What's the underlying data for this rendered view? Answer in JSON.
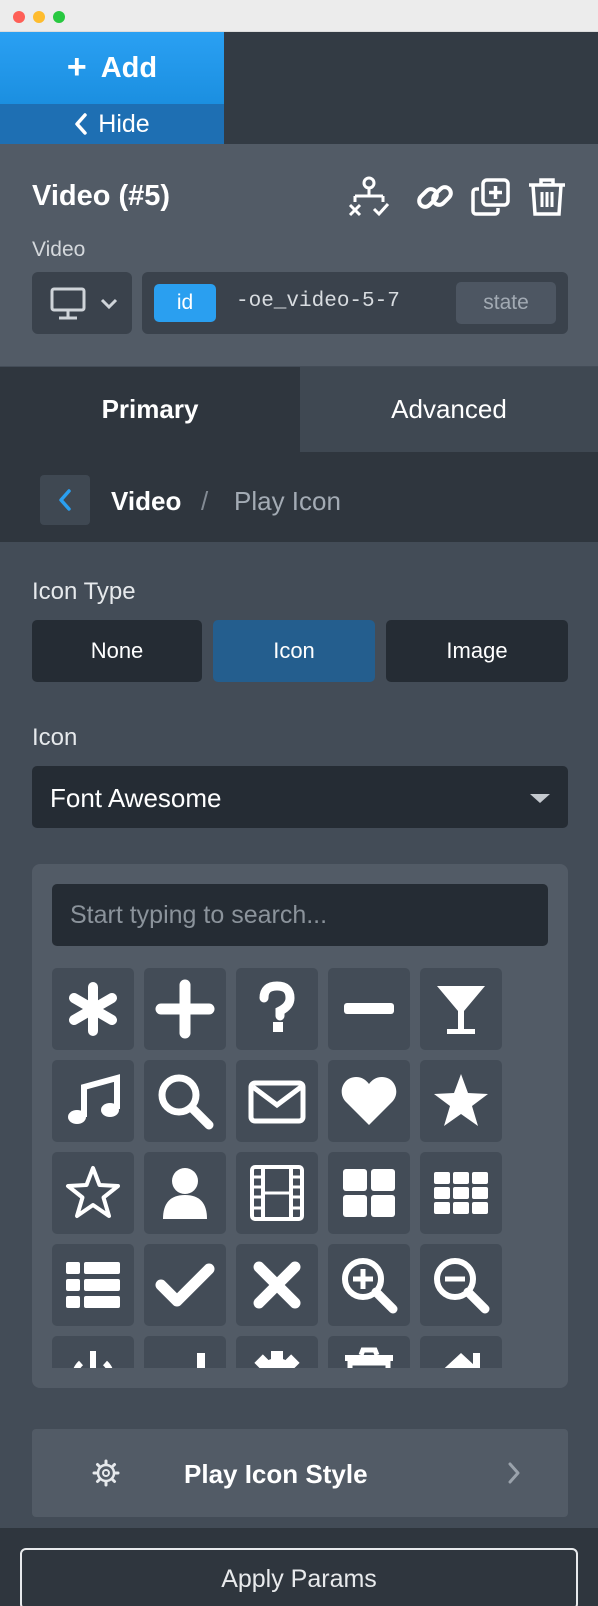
{
  "toolbar": {
    "add_label": "Add",
    "hide_label": "Hide"
  },
  "element": {
    "title": "Video (#5)",
    "subtitle": "Video"
  },
  "header_icons": [
    "structure-icon",
    "link-icon",
    "duplicate-icon",
    "trash-icon"
  ],
  "selector": {
    "device_icon": "desktop-icon",
    "id_label": "id",
    "id_value": "-oe_video-5-7",
    "state_label": "state"
  },
  "tabs": {
    "primary": "Primary",
    "advanced": "Advanced"
  },
  "breadcrumb": {
    "parent": "Video",
    "separator": "/",
    "current": "Play Icon"
  },
  "icon_type": {
    "label": "Icon Type",
    "options": [
      "None",
      "Icon",
      "Image"
    ],
    "selected": "Icon"
  },
  "icon": {
    "label": "Icon",
    "library": "Font Awesome"
  },
  "icon_picker": {
    "search_placeholder": "Start typing to search...",
    "icons": [
      "asterisk",
      "plus",
      "question",
      "minus",
      "glass",
      "music",
      "search",
      "envelope",
      "heart",
      "star",
      "star-o",
      "user",
      "film",
      "th-large",
      "th",
      "th-list",
      "check",
      "times",
      "search-plus",
      "search-minus",
      "power-off",
      "signal",
      "cog",
      "trash",
      "home"
    ]
  },
  "style_section": {
    "label": "Play Icon Style",
    "icon": "gear-icon"
  },
  "footer": {
    "apply_label": "Apply Params"
  },
  "colors": {
    "accent": "#2a9ff0",
    "active_segment": "#245e8e",
    "panel": "#434c57",
    "dark": "#252c34"
  }
}
